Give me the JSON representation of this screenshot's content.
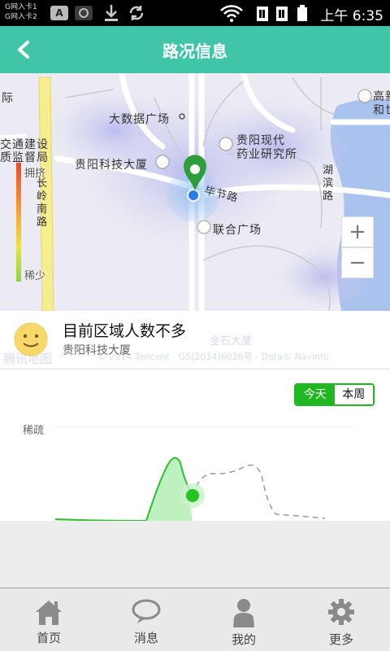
{
  "status_bar": {
    "sim1": "G网入卡1",
    "sim2": "G网入卡2",
    "a_badge": "A",
    "clock": "上午 6:35"
  },
  "header": {
    "title": "路况信息"
  },
  "map": {
    "labels": {
      "big_data_plaza": "大数据广场",
      "guiyang_tech_building": "贵阳科技大厦",
      "guiyang_modern_pharma": "贵阳现代",
      "guiyang_modern_pharma2": "药业研究所",
      "lianhe_plaza": "联合广场",
      "bijie_road": "毕节路",
      "transport_construction": "交通建设",
      "quality_supervision": "质监督局",
      "changling_south_road": "长岭南路",
      "hubin_road": "湖滨路",
      "edge_left": "际",
      "edge_right_top": "高新",
      "edge_right_bottom": "和世"
    },
    "legend": {
      "high": "拥挤",
      "low": "稀少"
    },
    "zoom_in": "+",
    "zoom_out": "−"
  },
  "info_card": {
    "title": "目前区域人数不多",
    "subtitle": "贵阳科技大厦",
    "watermark_left": "腾讯地图",
    "watermark_mid": "金石大厦",
    "watermark_bottom": "© 2014 Tencent - GS(2014)6026号 - Data© Navinfo"
  },
  "chart": {
    "toggle_today": "今天",
    "toggle_week": "本周",
    "y_label": "稀疏",
    "colors": {
      "today": "#2ec12e",
      "forecast": "#999999"
    }
  },
  "nav": {
    "home": "首页",
    "messages": "消息",
    "me": "我的",
    "more": "更多"
  }
}
